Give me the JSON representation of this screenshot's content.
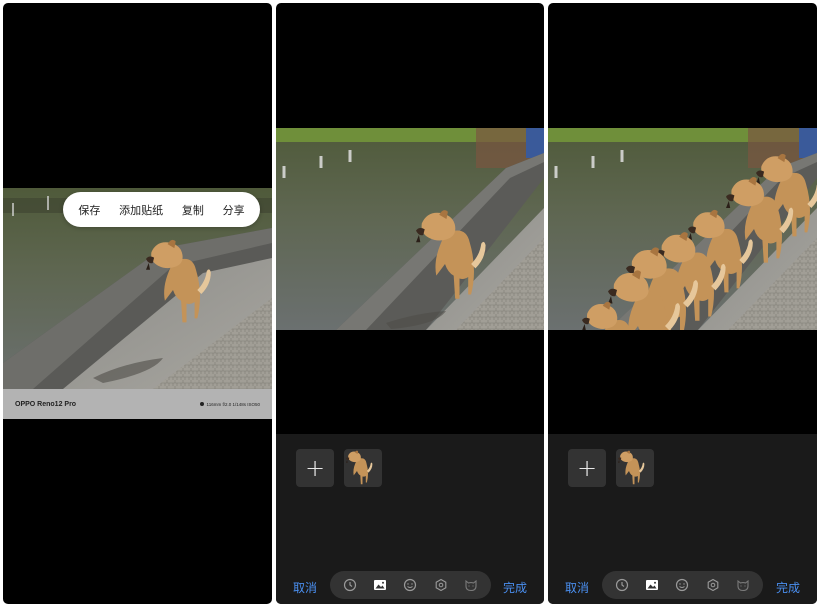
{
  "panel1": {
    "context_menu": [
      {
        "label": "保存"
      },
      {
        "label": "添加贴纸"
      },
      {
        "label": "复制"
      },
      {
        "label": "分享"
      }
    ],
    "watermark": {
      "model": "OPPO Reno12 Pro",
      "specs": "116mm f/2.0 1/148s ISO50"
    }
  },
  "editor": {
    "add_label": "+",
    "cancel_label": "取消",
    "done_label": "完成",
    "tools": [
      {
        "icon": "clock-icon"
      },
      {
        "icon": "image-icon",
        "active": true
      },
      {
        "icon": "emoji-icon"
      },
      {
        "icon": "settings-icon"
      },
      {
        "icon": "cat-icon"
      }
    ]
  },
  "colors": {
    "accent": "#4a8ff0",
    "panel_bg": "#000000",
    "tray_bg": "#1a1a1a",
    "button_bg": "#333333",
    "watermark_bg": "#b3b3b3"
  }
}
